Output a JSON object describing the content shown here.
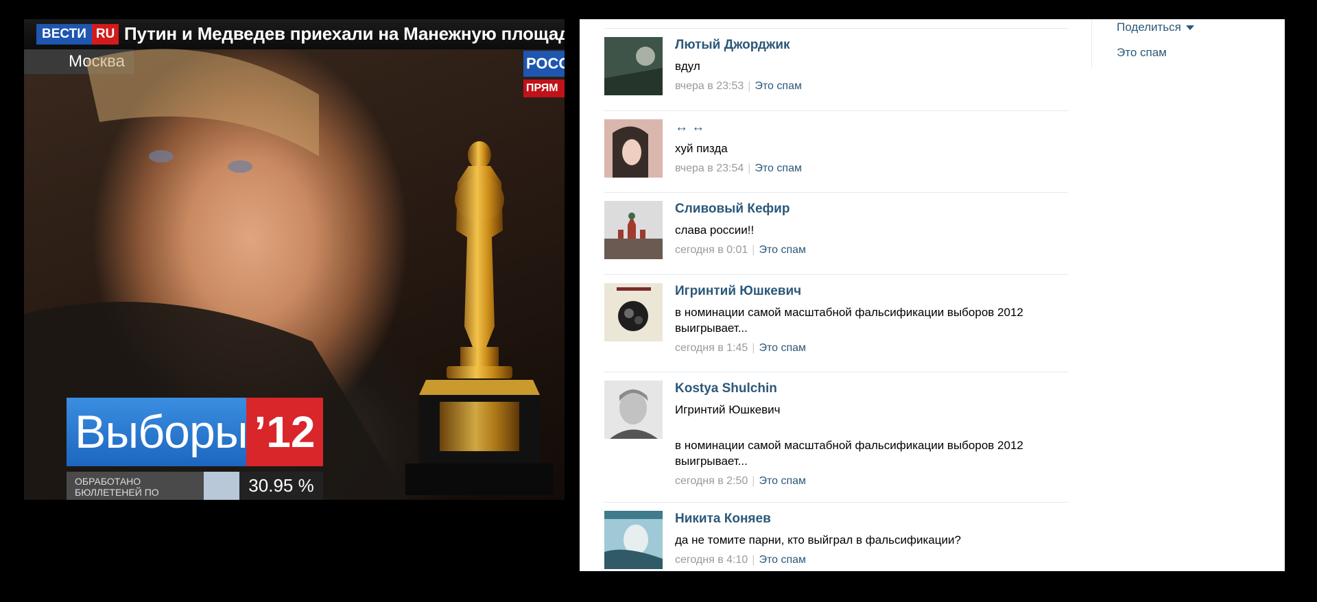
{
  "broadcast": {
    "logo_left": "ВЕСТИ",
    "logo_right": "RU",
    "headline": "Путин и Медведев приехали на Манежную площадь",
    "city": "Москва",
    "channel": "РОСС",
    "live": "ПРЯМ",
    "election_word": "Выборы",
    "election_year": "’12",
    "counter_label": "ОБРАБОТАНО БЮЛЛЕТЕНЕЙ ПО ДАННЫМ ЦИК",
    "counter_value": "30.95 %"
  },
  "sidebar": {
    "share_label": "Поделиться",
    "spam_label": "Это спам"
  },
  "comments": [
    {
      "author": "Лютый Джорджик",
      "text": "вдул",
      "date": "вчера в 23:53",
      "spam": "Это спам"
    },
    {
      "author": "↔ ↔",
      "text": "хуй пизда",
      "date": "вчера в 23:54",
      "spam": "Это спам"
    },
    {
      "author": "Сливовый Кефир",
      "text": "слава россии!!",
      "date": "сегодня в 0:01",
      "spam": "Это спам"
    },
    {
      "author": "Игринтий Юшкевич",
      "text": "в номинации самой масштабной фальсификации выборов 2012 выигрывает...",
      "date": "сегодня в 1:45",
      "spam": "Это спам"
    },
    {
      "author": "Kostya Shulchin",
      "quote_name": "Игринтий Юшкевич",
      "text": "в номинации самой масштабной фальсификации выборов 2012 выигрывает...",
      "date": "сегодня в 2:50",
      "spam": "Это спам"
    },
    {
      "author": "Никита Коняев",
      "text": "да не томите парни, кто выйграл в фальсификации?",
      "date": "сегодня в 4:10",
      "spam": "Это спам"
    }
  ],
  "colors": {
    "link": "#2b587a",
    "meta": "#999999",
    "divider": "#e4e8ed",
    "vesti_blue": "#1e56b0",
    "vesti_red": "#d21b1b"
  }
}
